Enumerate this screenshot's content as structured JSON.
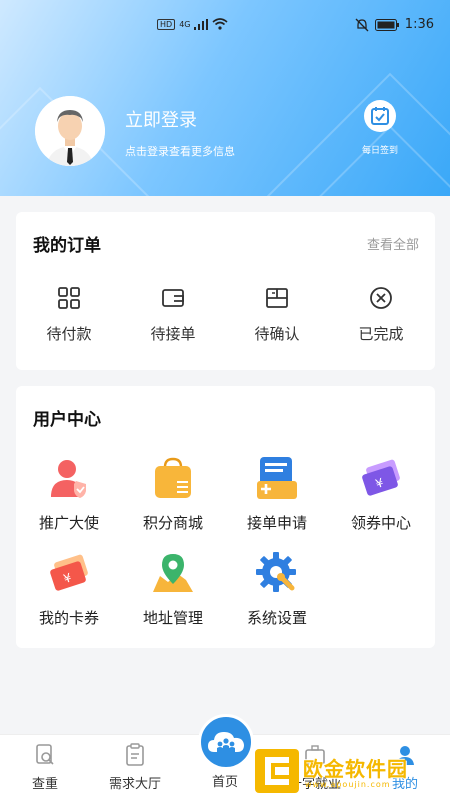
{
  "status_bar": {
    "network": "HD",
    "signal": "4G",
    "time": "1:36"
  },
  "header": {
    "login_title": "立即登录",
    "login_subtitle": "点击登录查看更多信息",
    "checkin_label": "每日签到"
  },
  "orders": {
    "title": "我的订单",
    "see_all": "查看全部",
    "items": [
      {
        "label": "待付款",
        "icon": "grid-icon"
      },
      {
        "label": "待接单",
        "icon": "wallet-icon"
      },
      {
        "label": "待确认",
        "icon": "book-icon"
      },
      {
        "label": "已完成",
        "icon": "close-circle-icon"
      }
    ]
  },
  "user_center": {
    "title": "用户中心",
    "items": [
      {
        "label": "推广大使",
        "icon": "user-shield-icon"
      },
      {
        "label": "积分商城",
        "icon": "shopping-bag-icon"
      },
      {
        "label": "接单申请",
        "icon": "application-icon"
      },
      {
        "label": "领券中心",
        "icon": "coupon-icon"
      },
      {
        "label": "我的卡券",
        "icon": "ticket-icon"
      },
      {
        "label": "地址管理",
        "icon": "map-pin-icon"
      },
      {
        "label": "系统设置",
        "icon": "settings-icon"
      }
    ]
  },
  "tabbar": {
    "items": [
      {
        "label": "查重",
        "icon": "check-doc-icon"
      },
      {
        "label": "需求大厅",
        "icon": "clipboard-icon"
      },
      {
        "label": "首页",
        "icon": "home-cloud-icon"
      },
      {
        "label": "十字就业",
        "icon": "briefcase-icon"
      },
      {
        "label": "我的",
        "icon": "person-icon"
      }
    ]
  },
  "watermark": {
    "name": "欧金软件园",
    "url": "www.apoujin.com"
  },
  "colors": {
    "accent": "#2e8fe3",
    "header_start": "#cfe9ff",
    "header_end": "#3aa8f8",
    "watermark": "#f5b800"
  }
}
